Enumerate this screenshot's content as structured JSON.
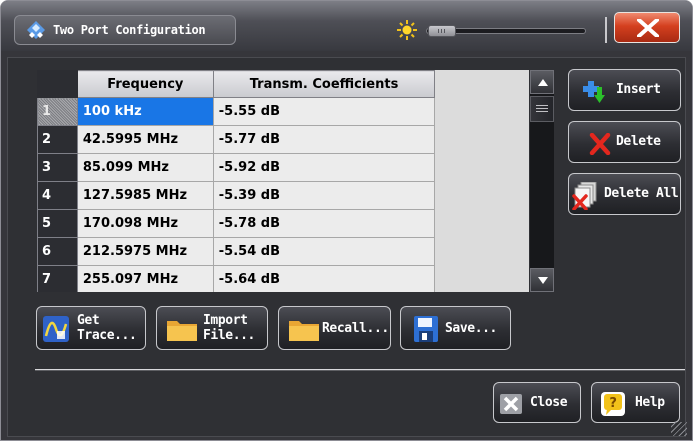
{
  "window": {
    "title": "Two Port Configuration"
  },
  "table": {
    "columns": [
      "Frequency",
      "Transm. Coefficients"
    ],
    "rows": [
      {
        "index": "1",
        "frequency": "100 kHz",
        "coefficient": "-5.55 dB"
      },
      {
        "index": "2",
        "frequency": "42.5995 MHz",
        "coefficient": "-5.77 dB"
      },
      {
        "index": "3",
        "frequency": "85.099 MHz",
        "coefficient": "-5.92 dB"
      },
      {
        "index": "4",
        "frequency": "127.5985 MHz",
        "coefficient": "-5.39 dB"
      },
      {
        "index": "5",
        "frequency": "170.098 MHz",
        "coefficient": "-5.78 dB"
      },
      {
        "index": "6",
        "frequency": "212.5975 MHz",
        "coefficient": "-5.54 dB"
      },
      {
        "index": "7",
        "frequency": "255.097 MHz",
        "coefficient": "-5.64 dB"
      }
    ],
    "selected_row": "1"
  },
  "side_buttons": {
    "insert": "Insert",
    "delete": "Delete",
    "delete_all": "Delete All"
  },
  "bottom_buttons": {
    "get_trace_1": "Get",
    "get_trace_2": "Trace...",
    "import_1": "Import",
    "import_2": "File...",
    "recall": "Recall...",
    "save": "Save..."
  },
  "footer": {
    "close": "Close",
    "help": "Help"
  },
  "icons": {
    "app": "diamond-config-icon",
    "brightness": "sun-icon",
    "close": "close-icon",
    "insert": "insert-icon",
    "delete": "delete-x-icon",
    "delete_all": "delete-all-icon",
    "trace": "trace-icon",
    "folder": "folder-icon",
    "save": "floppy-icon",
    "help": "help-icon"
  },
  "colors": {
    "selection": "#1976e6",
    "close_button": "#d4401f",
    "background": "#36363b"
  }
}
